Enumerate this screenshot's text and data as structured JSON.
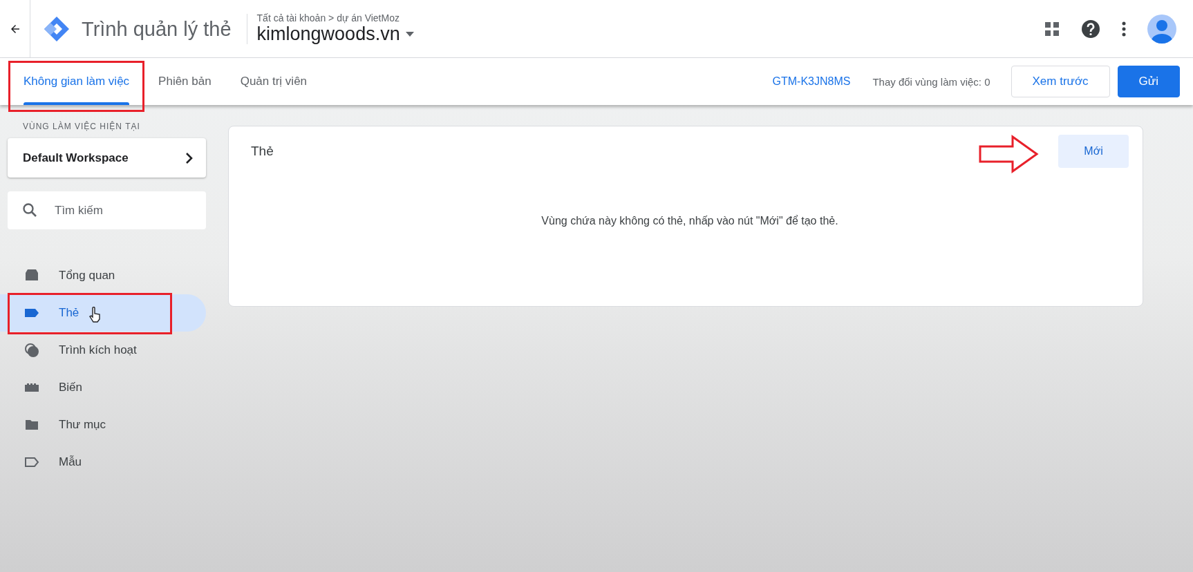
{
  "header": {
    "product": "Trình quản lý thẻ",
    "breadcrumb": "Tất cả tài khoản > dự án VietMoz",
    "container": "kimlongwoods.vn"
  },
  "tabs": [
    {
      "label": "Không gian làm việc",
      "selected": true,
      "annotated": true
    },
    {
      "label": "Phiên bản",
      "selected": false,
      "annotated": false
    },
    {
      "label": "Quản trị viên",
      "selected": false,
      "annotated": false
    }
  ],
  "toolbar": {
    "container_id": "GTM-K3JN8MS",
    "changes": "Thay đổi vùng làm việc: 0",
    "preview_button": "Xem trước",
    "submit_button": "Gửi"
  },
  "sidebar": {
    "workspace_label": "VÙNG LÀM VIỆC HIỆN TẠI",
    "workspace": "Default Workspace",
    "search_placeholder": "Tìm kiếm",
    "items": [
      {
        "kind": "overview",
        "label": "Tổng quan",
        "selected": false,
        "annotated": false
      },
      {
        "kind": "tag",
        "label": "Thẻ",
        "selected": true,
        "annotated": true
      },
      {
        "kind": "trigger",
        "label": "Trình kích hoạt",
        "selected": false,
        "annotated": false
      },
      {
        "kind": "variable",
        "label": "Biến",
        "selected": false,
        "annotated": false
      },
      {
        "kind": "folder",
        "label": "Thư mục",
        "selected": false,
        "annotated": false
      },
      {
        "kind": "template",
        "label": "Mẫu",
        "selected": false,
        "annotated": false
      }
    ]
  },
  "card": {
    "title": "Thẻ",
    "new_button": "Mới",
    "arrow_annotation": true,
    "empty_message": "Vùng chứa này không có thẻ, nhấp vào nút \"Mới\" để tạo thẻ."
  }
}
